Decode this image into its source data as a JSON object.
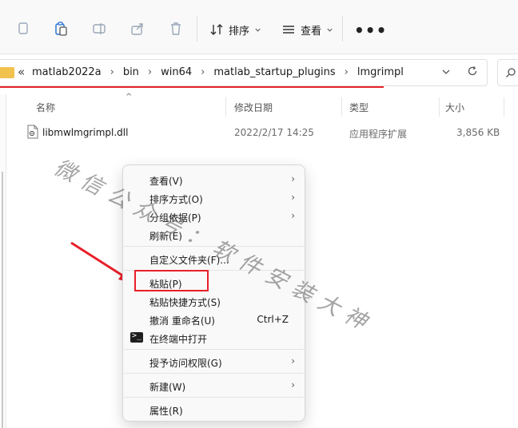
{
  "toolbar": {
    "icons": [
      "copy-icon",
      "paste-icon",
      "rename-icon",
      "share-icon",
      "delete-icon"
    ],
    "sort_label": "排序",
    "view_label": "查看",
    "more_label": "•••"
  },
  "address": {
    "overflow": "«",
    "crumbs": [
      "matlab2022a",
      "bin",
      "win64",
      "matlab_startup_plugins",
      "lmgrimpl"
    ],
    "separator": "›"
  },
  "columns": {
    "name": "名称",
    "modified": "修改日期",
    "type": "类型",
    "size": "大小"
  },
  "files": [
    {
      "name": "libmwlmgrimpl.dll",
      "modified": "2022/2/17 14:25",
      "type": "应用程序扩展",
      "size": "3,856 KB"
    }
  ],
  "watermark": "微信公众号：软件安装大神",
  "context_menu": {
    "items": [
      {
        "label": "查看(V)",
        "submenu": true
      },
      {
        "label": "排序方式(O)",
        "submenu": true
      },
      {
        "label": "分组依据(P)",
        "submenu": true
      },
      {
        "label": "刷新(E)"
      },
      {
        "label": "自定义文件夹(F)..."
      },
      {
        "label": "粘贴(P)"
      },
      {
        "label": "粘贴快捷方式(S)"
      },
      {
        "label": "撤消 重命名(U)",
        "shortcut": "Ctrl+Z"
      },
      {
        "label": "在终端中打开",
        "icon": "terminal-icon"
      },
      {
        "label": "授予访问权限(G)",
        "submenu": true
      },
      {
        "label": "新建(W)",
        "submenu": true
      },
      {
        "label": "属性(R)"
      }
    ],
    "submenu_glyph": "›"
  },
  "colors": {
    "highlight": "#e8202a",
    "folder": "#f1c24d"
  }
}
